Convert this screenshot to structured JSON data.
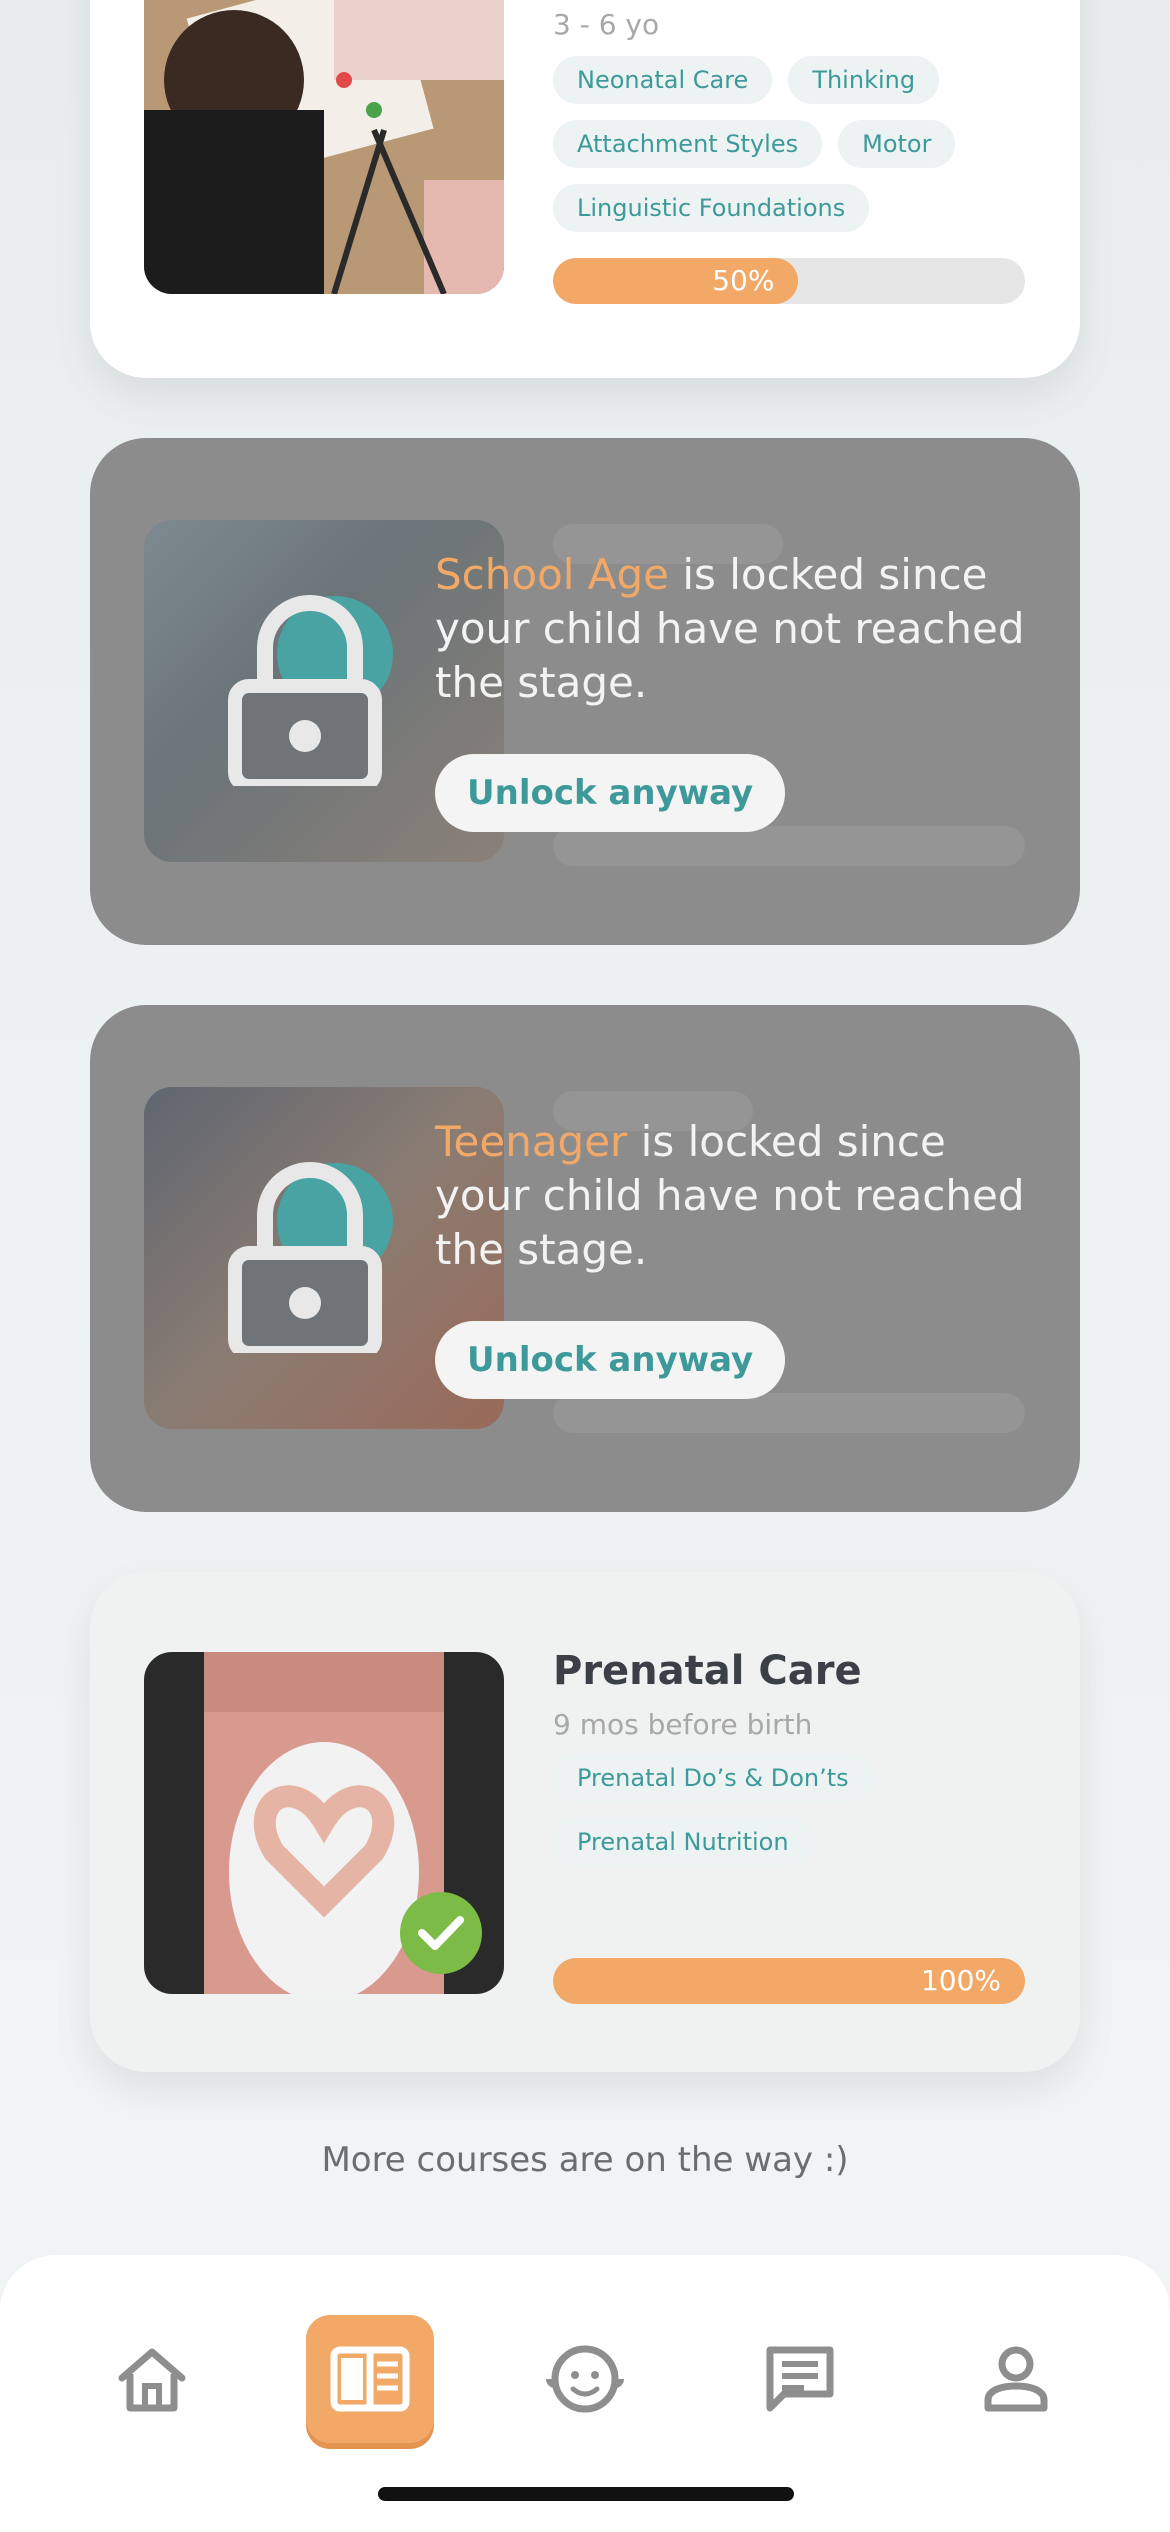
{
  "cards": [
    {
      "age": "3 - 6 yo",
      "tags": [
        "Neonatal Care",
        "Thinking",
        "Attachment Styles",
        "Motor",
        "Linguistic Foundations"
      ],
      "progress_label": "50%",
      "progress_value": 0.5
    },
    {
      "locked": true,
      "stage_name": "School Age",
      "lock_text": " is locked since your child have not reached the stage.",
      "unlock_label": "Unlock anyway"
    },
    {
      "locked": true,
      "stage_name": "Teenager",
      "lock_text": " is locked since your child have not reached the stage.",
      "unlock_label": "Unlock anyway"
    },
    {
      "title": "Prenatal Care",
      "age": "9 mos before birth",
      "tags": [
        "Prenatal Do’s & Don’ts",
        "Prenatal Nutrition"
      ],
      "progress_label": "100%",
      "progress_value": 1.0,
      "completed": true
    }
  ],
  "footer_text": "More courses are on the way :)",
  "tabbar": {
    "items": [
      {
        "icon": "home-icon",
        "active": false
      },
      {
        "icon": "courses-book-icon",
        "active": true
      },
      {
        "icon": "baby-face-icon",
        "active": false
      },
      {
        "icon": "chat-icon",
        "active": false
      },
      {
        "icon": "profile-icon",
        "active": false
      }
    ]
  },
  "colors": {
    "accent_orange": "#f2a968",
    "teal": "#3e9a9a",
    "locked_overlay": "#8c8c8c",
    "check_green": "#7cbb45"
  }
}
